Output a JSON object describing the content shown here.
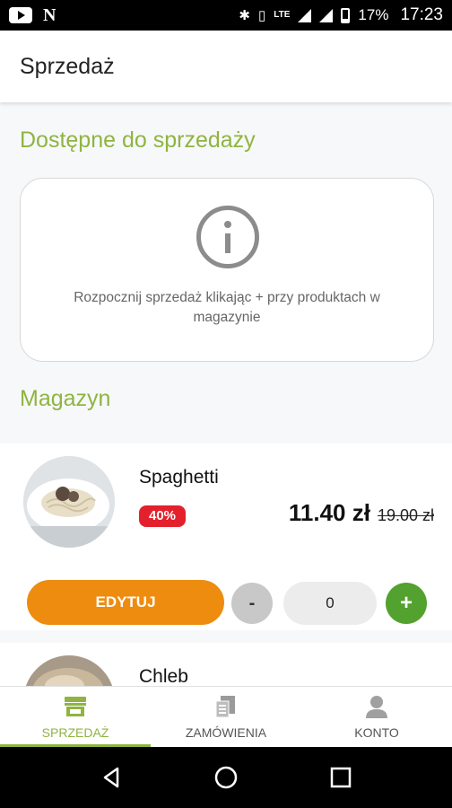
{
  "status_bar": {
    "icons_left": [
      "youtube-icon",
      "netflix-icon"
    ],
    "lte_label": "LTE",
    "battery_percent": "17%",
    "time": "17:23"
  },
  "header": {
    "title": "Sprzedaż"
  },
  "available": {
    "section_title": "Dostępne do sprzedaży",
    "info_icon": "info-icon",
    "info_text": "Rozpocznij sprzedaż klikając + przy produktach w magazynie"
  },
  "stock": {
    "section_title": "Magazyn",
    "products": [
      {
        "name": "Spaghetti",
        "discount": "40%",
        "price": "11.40 zł",
        "old_price": "19.00 zł",
        "edit_label": "EDYTUJ",
        "minus_label": "-",
        "quantity": "0",
        "plus_label": "+"
      },
      {
        "name": "Chleb"
      }
    ]
  },
  "nav": {
    "items": [
      {
        "label": "SPRZEDAŻ",
        "icon": "store-icon",
        "active": true
      },
      {
        "label": "ZAMÓWIENIA",
        "icon": "orders-icon",
        "active": false
      },
      {
        "label": "KONTO",
        "icon": "account-icon",
        "active": false
      }
    ]
  },
  "colors": {
    "accent_green": "#8fb440",
    "edit_orange": "#ee8c10",
    "discount_red": "#e3212d",
    "plus_green": "#53a12f"
  }
}
